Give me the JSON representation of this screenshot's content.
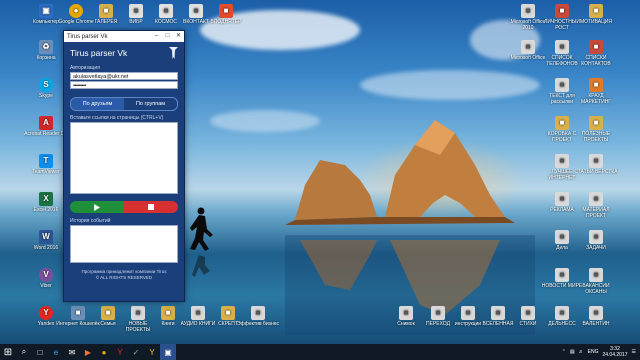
{
  "window": {
    "title": "Tirus parser Vk",
    "app_name": "Tirus parser Vk",
    "auth_label": "Авторизация",
    "login_value": "akulasvetlaya@ukr.net",
    "password_value": "•••••••••",
    "tabs": [
      "По друзьям",
      "По группам"
    ],
    "links_label": "Вставьте ссылки на страницы (CTRL+V)",
    "history_label": "История событий",
    "footer_line1": "Программа принадлежит компании Tirus",
    "footer_line2": "© ALL RIGHTS RESERVED",
    "minimize": "–",
    "maximize": "□",
    "close": "✕"
  },
  "desktop_icons_left": [
    {
      "label": "Компьютер",
      "color": "#2b6cc4",
      "glyph": "▣"
    },
    {
      "label": "Корзина",
      "color": "#6b8fb8",
      "glyph": "♻"
    },
    {
      "label": "Skype",
      "color": "#00a9e8",
      "glyph": "S"
    },
    {
      "label": "Acrobat Reader DC",
      "color": "#d4262a",
      "glyph": "A"
    },
    {
      "label": "TeamViewer",
      "color": "#0e8ee9",
      "glyph": "T"
    },
    {
      "label": "Excel 2016",
      "color": "#1d7244",
      "glyph": "X"
    },
    {
      "label": "Word 2016",
      "color": "#2b5797",
      "glyph": "W"
    },
    {
      "label": "Viber",
      "color": "#7b519d",
      "glyph": "V"
    },
    {
      "label": "Yandex",
      "color": "#e52620",
      "glyph": "Y"
    }
  ],
  "desktop_icons_top": [
    {
      "label": "Google Chrome",
      "color": "#e8a700",
      "glyph": "●"
    },
    {
      "label": "ГАЛЕРЕЯ",
      "color": "#d8b04a",
      "glyph": "■"
    },
    {
      "label": "ВИБР",
      "color": "#e0e0e0",
      "glyph": "■"
    },
    {
      "label": "КОСМОС",
      "color": "#e0e0e0",
      "glyph": "■"
    },
    {
      "label": "ВКОНТАКТ",
      "color": "#e0e0e0",
      "glyph": "■"
    },
    {
      "label": "ВПОДНЯТЕР",
      "color": "#e34b2a",
      "glyph": "■"
    }
  ],
  "desktop_icons_right": [
    {
      "label": "Microsoft Office 2010",
      "color": "#d9d9d9",
      "glyph": "■"
    },
    {
      "label": "ЛИЧНОСТНЫЙ РОСТ",
      "color": "#c94a3a",
      "glyph": "■"
    },
    {
      "label": "МОТИВАЦИЯ",
      "color": "#d8b04a",
      "glyph": "■"
    },
    {
      "label": "Microsoft Office",
      "color": "#d9d9d9",
      "glyph": "■"
    },
    {
      "label": "СПИСОК ТЕЛЕФОНОВ",
      "color": "#d9d9d9",
      "glyph": "■"
    },
    {
      "label": "СПИСКИ КОНТАКТОВ",
      "color": "#c94a3a",
      "glyph": "■"
    },
    {
      "label": "ТЕКСТ для рассылки",
      "color": "#d9d9d9",
      "glyph": "■"
    },
    {
      "label": "КРАУД МАРКЕТИНГ",
      "color": "#e07a2a",
      "glyph": "■"
    },
    {
      "label": "КОРОБКА С ПРОЕКТ",
      "color": "#d8b04a",
      "glyph": "■"
    },
    {
      "label": "ПОЛЕЗНЫЕ ПРОЕКТЫ",
      "color": "#d8b04a",
      "glyph": "■"
    },
    {
      "label": "ЛУЧШЕЕ ИНТЕРНЕТ",
      "color": "#d9d9d9",
      "glyph": "■"
    },
    {
      "label": "СТАТЬИ ВЕРСТКА",
      "color": "#d9d9d9",
      "glyph": "■"
    },
    {
      "label": "РЕКЛАМА",
      "color": "#d9d9d9",
      "glyph": "■"
    },
    {
      "label": "МАТЕРИАЛ ПРОЕКТ",
      "color": "#d9d9d9",
      "glyph": "■"
    },
    {
      "label": "Дела",
      "color": "#d9d9d9",
      "glyph": "■"
    },
    {
      "label": "ЗАДАЧИ",
      "color": "#d9d9d9",
      "glyph": "■"
    },
    {
      "label": "НОВОСТИ МИРЕ",
      "color": "#d9d9d9",
      "glyph": "■"
    },
    {
      "label": "ВАКАНСИИ ОКСАНЫ",
      "color": "#d9d9d9",
      "glyph": "■"
    },
    {
      "label": "ДЕЛЬНЕСС",
      "color": "#d9d9d9",
      "glyph": "■"
    },
    {
      "label": "ВАЛЕНТИН",
      "color": "#d9d9d9",
      "glyph": "■"
    }
  ],
  "desktop_icons_bottom": [
    {
      "label": "Yandex",
      "color": "#e52620",
      "glyph": "Y"
    },
    {
      "label": "Интернет Кошелёк",
      "color": "#6b8fb8",
      "glyph": "■"
    },
    {
      "label": "Семья",
      "color": "#d8b04a",
      "glyph": "■"
    },
    {
      "label": "НОВЫЕ ПРОЕКТЫ",
      "color": "#d9d9d9",
      "glyph": "■"
    },
    {
      "label": "Книги",
      "color": "#d8b04a",
      "glyph": "■"
    },
    {
      "label": "АУДИО КНИГИ",
      "color": "#d9d9d9",
      "glyph": "■"
    },
    {
      "label": "СКРЕПТ",
      "color": "#d8b04a",
      "glyph": "■"
    },
    {
      "label": "Эффектив бизнес",
      "color": "#d9d9d9",
      "glyph": "■"
    },
    {
      "label": "Снимок",
      "color": "#d9d9d9",
      "glyph": "■"
    },
    {
      "label": "ПЕРЕХОД",
      "color": "#d9d9d9",
      "glyph": "■"
    },
    {
      "label": "инструкции",
      "color": "#d9d9d9",
      "glyph": "■"
    },
    {
      "label": "ВСЕЛЕННАЯ",
      "color": "#d9d9d9",
      "glyph": "■"
    },
    {
      "label": "СТИХИ",
      "color": "#d9d9d9",
      "glyph": "■"
    }
  ],
  "taskbar": {
    "start_glyph": "⊞",
    "apps": [
      "⌕",
      "□",
      "e",
      "✉",
      "▶",
      "●",
      "Y",
      "✓",
      "Y",
      "▣"
    ],
    "language": "ENG",
    "time": "3:32",
    "date": "24.04.2017"
  }
}
